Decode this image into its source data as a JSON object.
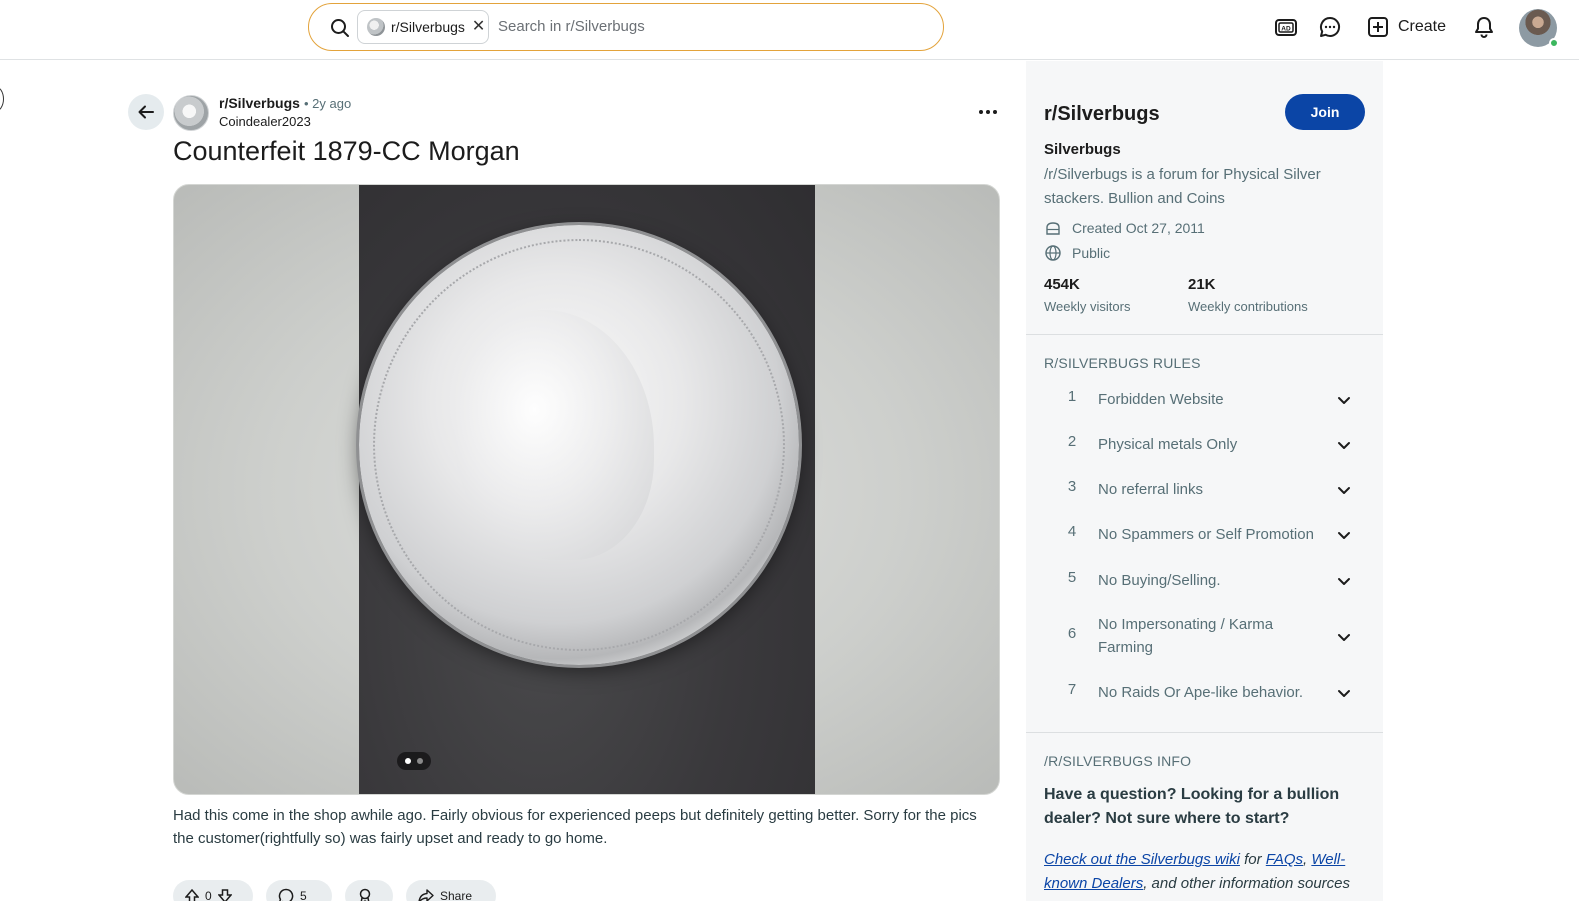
{
  "header": {
    "search_chip": "r/Silverbugs",
    "search_placeholder": "Search in r/Silverbugs",
    "create_label": "Create"
  },
  "post": {
    "subreddit": "r/Silverbugs",
    "time": "• 2y ago",
    "author": "Coindealer2023",
    "title": "Counterfeit 1879-CC Morgan",
    "body": "Had this come in the shop awhile ago. Fairly obvious for experienced peeps but definitely getting better. Sorry for the pics the customer(rightfully so) was fairly upset and ready to go home.",
    "gallery_total": 2,
    "gallery_current": 1,
    "actions": {
      "votes": "0",
      "comments": "5",
      "share_label": "Share"
    }
  },
  "sidebar": {
    "name": "r/Silverbugs",
    "join_label": "Join",
    "title": "Silverbugs",
    "description": "/r/Silverbugs is a forum for Physical Silver stackers. Bullion and Coins",
    "created": "Created Oct 27, 2011",
    "visibility": "Public",
    "stats": [
      {
        "value": "454K",
        "label": "Weekly visitors"
      },
      {
        "value": "21K",
        "label": "Weekly contributions"
      }
    ],
    "rules_header": "R/SILVERBUGS RULES",
    "rules": [
      {
        "num": "1",
        "text": "Forbidden Website"
      },
      {
        "num": "2",
        "text": "Physical metals Only"
      },
      {
        "num": "3",
        "text": "No referral links"
      },
      {
        "num": "4",
        "text": "No Spammers or Self Promotion"
      },
      {
        "num": "5",
        "text": "No Buying/Selling."
      },
      {
        "num": "6",
        "text": "No Impersonating / Karma Farming"
      },
      {
        "num": "7",
        "text": "No Raids Or Ape-like behavior."
      }
    ],
    "info_header": "/R/SILVERBUGS INFO",
    "info_question": "Have a question? Looking for a bullion dealer? Not sure where to start?",
    "info_link1": "Check out the Silverbugs wiki",
    "info_for": " for ",
    "info_link2": "FAQs",
    "info_comma": ", ",
    "info_link3": "Well-known Dealers",
    "info_tail": ", and other information sources"
  },
  "colors": {
    "join_button": "#0b45a6",
    "search_border": "#e3a33b",
    "link": "#0b45a6"
  }
}
